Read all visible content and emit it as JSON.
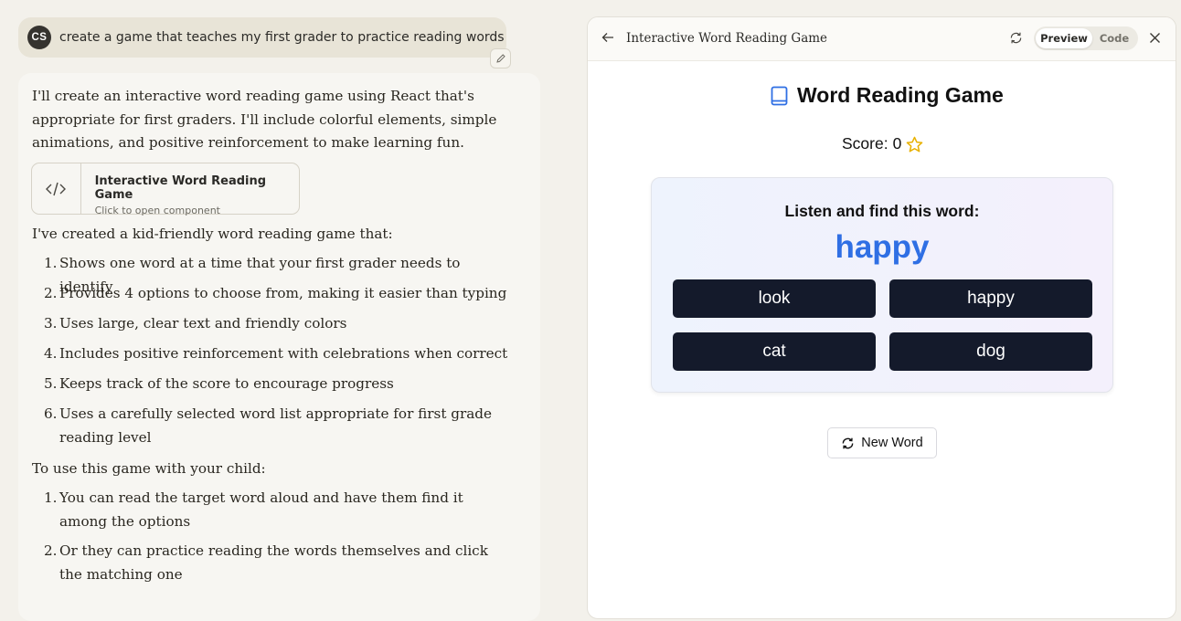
{
  "user_message": {
    "avatar_initials": "CS",
    "text": "create a game that teaches my first grader to practice reading words"
  },
  "assistant": {
    "intro": "I'll create an interactive word reading game using React that's appropriate for first graders. I'll include colorful elements, simple animations, and positive reinforcement to make learning fun.",
    "artifact": {
      "title": "Interactive Word Reading Game",
      "subtitle": "Click to open component"
    },
    "features_intro": "I've created a kid-friendly word reading game that:",
    "features": [
      "Shows one word at a time that your first grader needs to identify",
      "Provides 4 options to choose from, making it easier than typing",
      "Uses large, clear text and friendly colors",
      "Includes positive reinforcement with celebrations when correct",
      "Keeps track of the score to encourage progress",
      "Uses a carefully selected word list appropriate for first grade reading level"
    ],
    "usage_intro": "To use this game with your child:",
    "usage": [
      "You can read the target word aloud and have them find it among the options",
      "Or they can practice reading the words themselves and click the matching one"
    ]
  },
  "panel": {
    "title": "Interactive Word Reading Game",
    "toggle": {
      "preview": "Preview",
      "code": "Code",
      "active": "Preview"
    },
    "game": {
      "title": "Word Reading Game",
      "score_label": "Score:",
      "score": "0",
      "prompt": "Listen and find this word:",
      "target_word": "happy",
      "options": [
        "look",
        "happy",
        "cat",
        "dog"
      ],
      "new_word_label": "New Word"
    }
  },
  "colors": {
    "target_word": "#2f6fe4",
    "option_bg": "#141a2b",
    "book_icon": "#2f6fe4",
    "star": "#e8b100"
  },
  "icons": [
    "pencil-icon",
    "code-icon",
    "back-arrow-icon",
    "refresh-icon",
    "close-icon",
    "book-icon",
    "star-icon",
    "refresh-icon"
  ]
}
